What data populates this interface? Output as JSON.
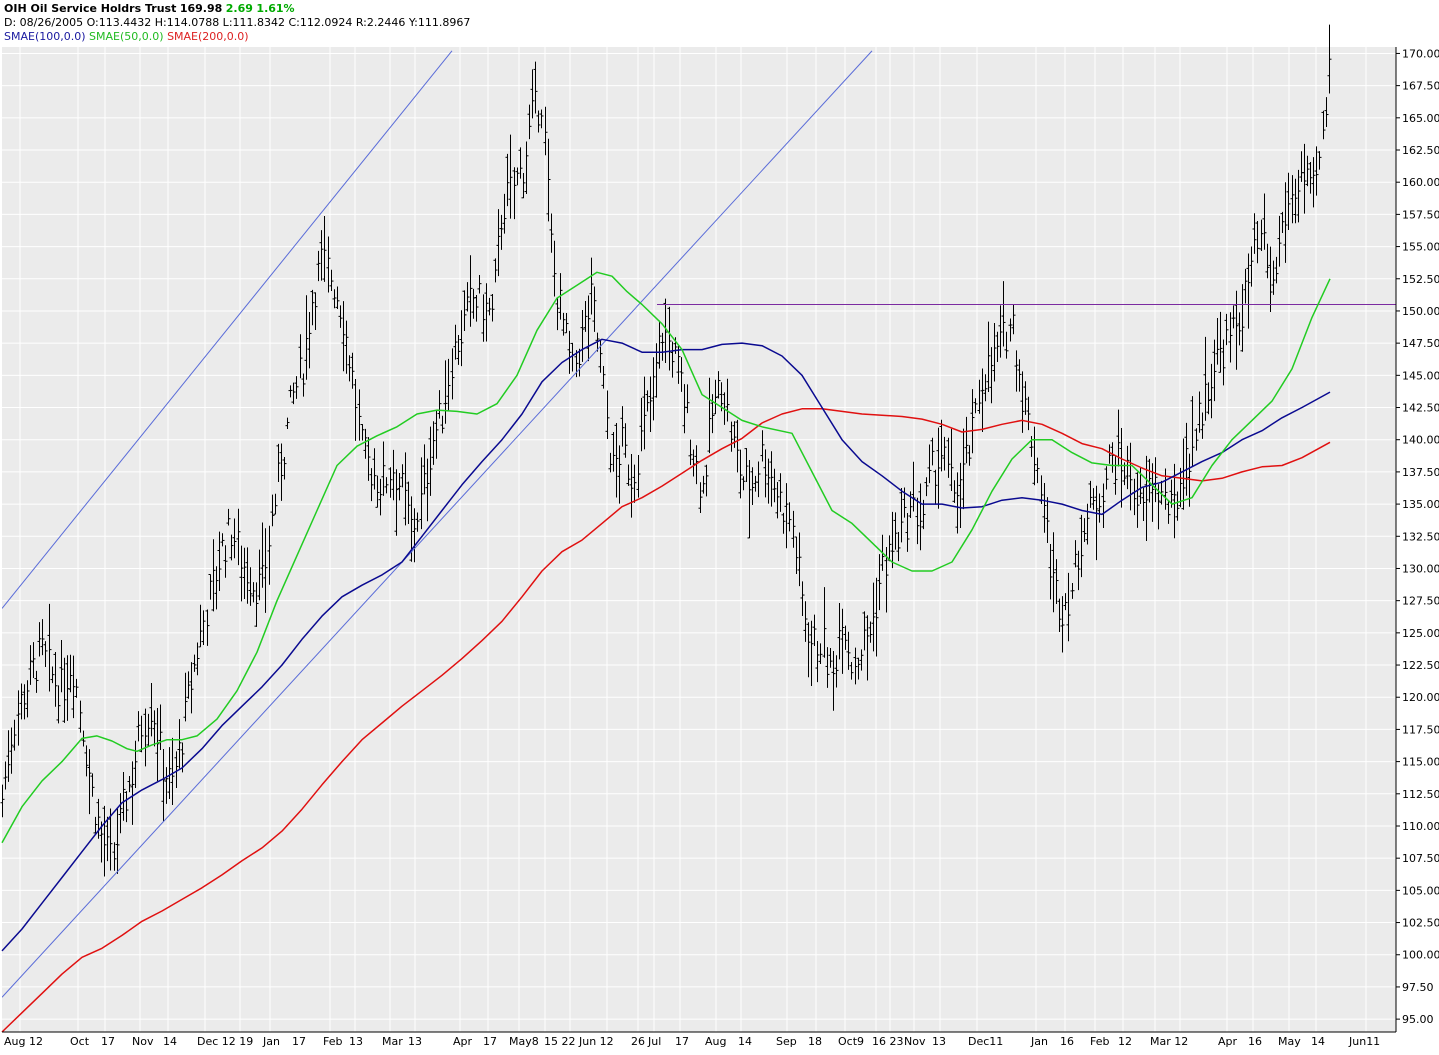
{
  "header": {
    "symbol_name": "OIH Oil Service Holdrs Trust",
    "last": "169.98",
    "change": "2.69",
    "change_pct": "1.61%",
    "ohlc_line": "D: 08/26/2005 O:113.4432 H:114.0788 L:111.8342 C:112.0924 R:2.2446 Y:111.8967",
    "ma_labels": [
      "SMAE(100,0.0)",
      "SMAE(50,0.0)",
      "SMAE(200,0.0)"
    ]
  },
  "colors": {
    "background": "#ebebeb",
    "grid": "#ffffff",
    "bars": "#000000",
    "sma50": "#22cc22",
    "sma100": "#0a0a90",
    "sma200": "#e01010",
    "trendline": "#5a6cd8",
    "hline": "#7a2aa0"
  },
  "chart_data": {
    "type": "ohlc",
    "ylim": [
      94.0,
      170.5
    ],
    "y_ticks": [
      95.0,
      97.5,
      100.0,
      102.5,
      105.0,
      107.5,
      110.0,
      112.5,
      115.0,
      117.5,
      120.0,
      122.5,
      125.0,
      127.5,
      130.0,
      132.5,
      135.0,
      137.5,
      140.0,
      142.5,
      145.0,
      147.5,
      150.0,
      152.5,
      155.0,
      157.5,
      160.0,
      162.5,
      165.0,
      167.5,
      170.0
    ],
    "x_labels": [
      "Aug 12",
      "Oct",
      "17",
      "Nov",
      "14",
      "Dec 12 19",
      "Jan",
      "17",
      "Feb",
      "13",
      "Mar",
      "13",
      "Apr",
      "17",
      "May8",
      "15 22",
      "Jun 12",
      "26",
      "Jul",
      "17",
      "Aug",
      "14",
      "Sep",
      "18",
      "Oct9",
      "16 23",
      "Nov",
      "13",
      "Dec11",
      "Jan",
      "16",
      "Feb",
      "12",
      "Mar 12",
      "Apr",
      "16",
      "May",
      "14",
      "Jun11"
    ],
    "time_period": "Aug 2005 - May 2006 (daily)",
    "close_series": [
      [
        0,
        112.1
      ],
      [
        10,
        117.5
      ],
      [
        20,
        120.0
      ],
      [
        30,
        122.0
      ],
      [
        40,
        123.5
      ],
      [
        50,
        121.5
      ],
      [
        60,
        120.5
      ],
      [
        70,
        123.0
      ],
      [
        80,
        118.0
      ],
      [
        90,
        112.5
      ],
      [
        100,
        109.0
      ],
      [
        110,
        107.0
      ],
      [
        120,
        111.0
      ],
      [
        130,
        114.0
      ],
      [
        140,
        118.0
      ],
      [
        150,
        119.5
      ],
      [
        160,
        115.0
      ],
      [
        170,
        113.0
      ],
      [
        180,
        117.0
      ],
      [
        190,
        121.5
      ],
      [
        200,
        125.5
      ],
      [
        210,
        128.5
      ],
      [
        220,
        131.5
      ],
      [
        230,
        133.0
      ],
      [
        240,
        130.5
      ],
      [
        250,
        129.0
      ],
      [
        260,
        128.5
      ],
      [
        270,
        134.0
      ],
      [
        280,
        138.5
      ],
      [
        290,
        143.0
      ],
      [
        300,
        145.5
      ],
      [
        310,
        151.0
      ],
      [
        320,
        154.0
      ],
      [
        330,
        152.5
      ],
      [
        340,
        150.0
      ],
      [
        350,
        145.0
      ],
      [
        360,
        139.0
      ],
      [
        370,
        137.5
      ],
      [
        380,
        136.5
      ],
      [
        390,
        138.0
      ],
      [
        400,
        136.0
      ],
      [
        410,
        133.0
      ],
      [
        420,
        135.5
      ],
      [
        430,
        140.0
      ],
      [
        440,
        142.0
      ],
      [
        450,
        146.5
      ],
      [
        460,
        148.5
      ],
      [
        470,
        151.0
      ],
      [
        480,
        150.5
      ],
      [
        490,
        149.5
      ],
      [
        500,
        158.0
      ],
      [
        510,
        159.5
      ],
      [
        520,
        161.0
      ],
      [
        530,
        165.0
      ],
      [
        540,
        166.5
      ],
      [
        550,
        153.5
      ],
      [
        560,
        149.5
      ],
      [
        570,
        145.0
      ],
      [
        580,
        148.0
      ],
      [
        590,
        151.0
      ],
      [
        600,
        145.0
      ],
      [
        610,
        137.5
      ],
      [
        620,
        139.5
      ],
      [
        630,
        137.0
      ],
      [
        640,
        140.5
      ],
      [
        650,
        143.5
      ],
      [
        660,
        148.5
      ],
      [
        670,
        147.0
      ],
      [
        680,
        144.0
      ],
      [
        690,
        139.5
      ],
      [
        700,
        136.0
      ],
      [
        710,
        142.0
      ],
      [
        720,
        144.5
      ],
      [
        730,
        140.0
      ],
      [
        740,
        137.0
      ],
      [
        750,
        136.5
      ],
      [
        760,
        139.0
      ],
      [
        770,
        137.0
      ],
      [
        780,
        135.0
      ],
      [
        790,
        133.5
      ],
      [
        800,
        127.5
      ],
      [
        810,
        124.0
      ],
      [
        820,
        124.5
      ],
      [
        830,
        121.0
      ],
      [
        840,
        127.0
      ],
      [
        850,
        122.5
      ],
      [
        860,
        124.0
      ],
      [
        870,
        125.5
      ],
      [
        880,
        130.0
      ],
      [
        890,
        131.5
      ],
      [
        900,
        133.0
      ],
      [
        910,
        134.5
      ],
      [
        920,
        134.0
      ],
      [
        930,
        137.5
      ],
      [
        940,
        139.0
      ],
      [
        950,
        136.0
      ],
      [
        960,
        137.0
      ],
      [
        970,
        140.0
      ],
      [
        980,
        145.0
      ],
      [
        990,
        146.0
      ],
      [
        1000,
        147.5
      ],
      [
        1010,
        149.5
      ],
      [
        1020,
        143.5
      ],
      [
        1030,
        140.0
      ],
      [
        1040,
        136.0
      ],
      [
        1050,
        129.0
      ],
      [
        1060,
        127.0
      ],
      [
        1070,
        128.5
      ],
      [
        1080,
        133.0
      ],
      [
        1090,
        134.5
      ],
      [
        1100,
        136.5
      ],
      [
        1110,
        138.5
      ],
      [
        1120,
        138.0
      ],
      [
        1130,
        137.0
      ],
      [
        1140,
        134.0
      ],
      [
        1150,
        137.0
      ],
      [
        1160,
        135.5
      ],
      [
        1170,
        134.0
      ],
      [
        1180,
        137.5
      ],
      [
        1190,
        139.5
      ],
      [
        1200,
        142.5
      ],
      [
        1210,
        145.5
      ],
      [
        1220,
        147.0
      ],
      [
        1230,
        148.0
      ],
      [
        1240,
        150.0
      ],
      [
        1250,
        153.5
      ],
      [
        1260,
        155.5
      ],
      [
        1270,
        151.0
      ],
      [
        1280,
        156.5
      ],
      [
        1290,
        159.0
      ],
      [
        1300,
        160.5
      ],
      [
        1310,
        158.5
      ],
      [
        1320,
        162.5
      ],
      [
        1328,
        169.98
      ]
    ],
    "sma50": [
      [
        0,
        108.7
      ],
      [
        20,
        111.5
      ],
      [
        40,
        113.5
      ],
      [
        60,
        115.0
      ],
      [
        80,
        116.8
      ],
      [
        95,
        117.0
      ],
      [
        110,
        116.6
      ],
      [
        125,
        116.0
      ],
      [
        135,
        115.8
      ],
      [
        150,
        116.3
      ],
      [
        165,
        116.7
      ],
      [
        180,
        116.7
      ],
      [
        195,
        117.0
      ],
      [
        215,
        118.3
      ],
      [
        235,
        120.5
      ],
      [
        255,
        123.5
      ],
      [
        275,
        127.5
      ],
      [
        295,
        131.0
      ],
      [
        315,
        134.5
      ],
      [
        335,
        138.0
      ],
      [
        355,
        139.5
      ],
      [
        375,
        140.3
      ],
      [
        395,
        141.0
      ],
      [
        415,
        142.0
      ],
      [
        435,
        142.3
      ],
      [
        455,
        142.2
      ],
      [
        475,
        142.0
      ],
      [
        495,
        142.8
      ],
      [
        515,
        145.0
      ],
      [
        535,
        148.5
      ],
      [
        555,
        151.0
      ],
      [
        575,
        152.0
      ],
      [
        595,
        153.0
      ],
      [
        610,
        152.7
      ],
      [
        625,
        151.5
      ],
      [
        640,
        150.5
      ],
      [
        660,
        149.0
      ],
      [
        680,
        147.0
      ],
      [
        700,
        143.5
      ],
      [
        720,
        142.5
      ],
      [
        740,
        141.5
      ],
      [
        760,
        141.0
      ],
      [
        790,
        140.5
      ],
      [
        810,
        137.5
      ],
      [
        830,
        134.5
      ],
      [
        850,
        133.5
      ],
      [
        870,
        132.0
      ],
      [
        890,
        130.5
      ],
      [
        910,
        129.8
      ],
      [
        930,
        129.8
      ],
      [
        950,
        130.5
      ],
      [
        970,
        133.0
      ],
      [
        990,
        136.0
      ],
      [
        1010,
        138.5
      ],
      [
        1030,
        140.0
      ],
      [
        1050,
        140.0
      ],
      [
        1070,
        139.0
      ],
      [
        1090,
        138.2
      ],
      [
        1110,
        138.0
      ],
      [
        1130,
        138.0
      ],
      [
        1150,
        136.5
      ],
      [
        1170,
        135.0
      ],
      [
        1190,
        135.5
      ],
      [
        1210,
        138.0
      ],
      [
        1230,
        140.0
      ],
      [
        1250,
        141.5
      ],
      [
        1270,
        143.0
      ],
      [
        1290,
        145.5
      ],
      [
        1310,
        149.5
      ],
      [
        1328,
        152.5
      ]
    ],
    "sma100": [
      [
        0,
        100.3
      ],
      [
        20,
        102.0
      ],
      [
        40,
        104.0
      ],
      [
        60,
        106.0
      ],
      [
        80,
        108.0
      ],
      [
        100,
        110.0
      ],
      [
        120,
        111.8
      ],
      [
        140,
        112.8
      ],
      [
        160,
        113.6
      ],
      [
        180,
        114.5
      ],
      [
        200,
        116.0
      ],
      [
        220,
        117.8
      ],
      [
        240,
        119.3
      ],
      [
        260,
        120.8
      ],
      [
        280,
        122.5
      ],
      [
        300,
        124.5
      ],
      [
        320,
        126.3
      ],
      [
        340,
        127.8
      ],
      [
        360,
        128.7
      ],
      [
        380,
        129.5
      ],
      [
        400,
        130.5
      ],
      [
        420,
        132.5
      ],
      [
        440,
        134.5
      ],
      [
        460,
        136.5
      ],
      [
        480,
        138.3
      ],
      [
        500,
        140.0
      ],
      [
        520,
        142.0
      ],
      [
        540,
        144.5
      ],
      [
        560,
        146.0
      ],
      [
        580,
        147.0
      ],
      [
        600,
        147.8
      ],
      [
        620,
        147.5
      ],
      [
        640,
        146.8
      ],
      [
        660,
        146.8
      ],
      [
        680,
        147.0
      ],
      [
        700,
        147.0
      ],
      [
        720,
        147.4
      ],
      [
        740,
        147.5
      ],
      [
        760,
        147.3
      ],
      [
        780,
        146.5
      ],
      [
        800,
        145.0
      ],
      [
        820,
        142.5
      ],
      [
        840,
        140.0
      ],
      [
        860,
        138.3
      ],
      [
        880,
        137.2
      ],
      [
        900,
        136.0
      ],
      [
        920,
        135.0
      ],
      [
        940,
        135.0
      ],
      [
        960,
        134.7
      ],
      [
        980,
        134.8
      ],
      [
        1000,
        135.3
      ],
      [
        1020,
        135.5
      ],
      [
        1040,
        135.3
      ],
      [
        1060,
        135.0
      ],
      [
        1080,
        134.5
      ],
      [
        1100,
        134.2
      ],
      [
        1120,
        135.3
      ],
      [
        1140,
        136.3
      ],
      [
        1160,
        136.7
      ],
      [
        1180,
        137.5
      ],
      [
        1200,
        138.3
      ],
      [
        1220,
        139.0
      ],
      [
        1240,
        140.0
      ],
      [
        1260,
        140.7
      ],
      [
        1280,
        141.7
      ],
      [
        1300,
        142.5
      ],
      [
        1328,
        143.7
      ]
    ],
    "sma200": [
      [
        0,
        94.0
      ],
      [
        20,
        95.5
      ],
      [
        40,
        97.0
      ],
      [
        60,
        98.5
      ],
      [
        80,
        99.8
      ],
      [
        100,
        100.5
      ],
      [
        120,
        101.5
      ],
      [
        140,
        102.6
      ],
      [
        160,
        103.4
      ],
      [
        180,
        104.3
      ],
      [
        200,
        105.2
      ],
      [
        220,
        106.2
      ],
      [
        240,
        107.3
      ],
      [
        260,
        108.3
      ],
      [
        280,
        109.6
      ],
      [
        300,
        111.3
      ],
      [
        320,
        113.2
      ],
      [
        340,
        115.0
      ],
      [
        360,
        116.7
      ],
      [
        380,
        118.0
      ],
      [
        400,
        119.3
      ],
      [
        420,
        120.5
      ],
      [
        440,
        121.7
      ],
      [
        460,
        123.0
      ],
      [
        480,
        124.4
      ],
      [
        500,
        125.9
      ],
      [
        520,
        127.8
      ],
      [
        540,
        129.8
      ],
      [
        560,
        131.3
      ],
      [
        580,
        132.2
      ],
      [
        600,
        133.5
      ],
      [
        620,
        134.8
      ],
      [
        640,
        135.5
      ],
      [
        660,
        136.4
      ],
      [
        680,
        137.4
      ],
      [
        700,
        138.4
      ],
      [
        720,
        139.3
      ],
      [
        740,
        140.1
      ],
      [
        760,
        141.3
      ],
      [
        780,
        142.0
      ],
      [
        800,
        142.4
      ],
      [
        820,
        142.4
      ],
      [
        840,
        142.2
      ],
      [
        860,
        142.0
      ],
      [
        880,
        141.9
      ],
      [
        900,
        141.8
      ],
      [
        920,
        141.6
      ],
      [
        940,
        141.2
      ],
      [
        960,
        140.6
      ],
      [
        980,
        140.8
      ],
      [
        1000,
        141.2
      ],
      [
        1020,
        141.5
      ],
      [
        1040,
        141.2
      ],
      [
        1060,
        140.5
      ],
      [
        1080,
        139.7
      ],
      [
        1100,
        139.3
      ],
      [
        1120,
        138.5
      ],
      [
        1140,
        137.8
      ],
      [
        1160,
        137.2
      ],
      [
        1180,
        137.0
      ],
      [
        1200,
        136.8
      ],
      [
        1220,
        137.0
      ],
      [
        1240,
        137.5
      ],
      [
        1260,
        137.9
      ],
      [
        1280,
        138.0
      ],
      [
        1300,
        138.6
      ],
      [
        1328,
        139.8
      ]
    ],
    "trendlines": [
      {
        "from": [
          0,
          126.9
        ],
        "to": [
          450,
          170.2
        ]
      },
      {
        "from": [
          0,
          96.7
        ],
        "to": [
          870,
          170.2
        ]
      }
    ],
    "horizontal_line": 150.5
  }
}
